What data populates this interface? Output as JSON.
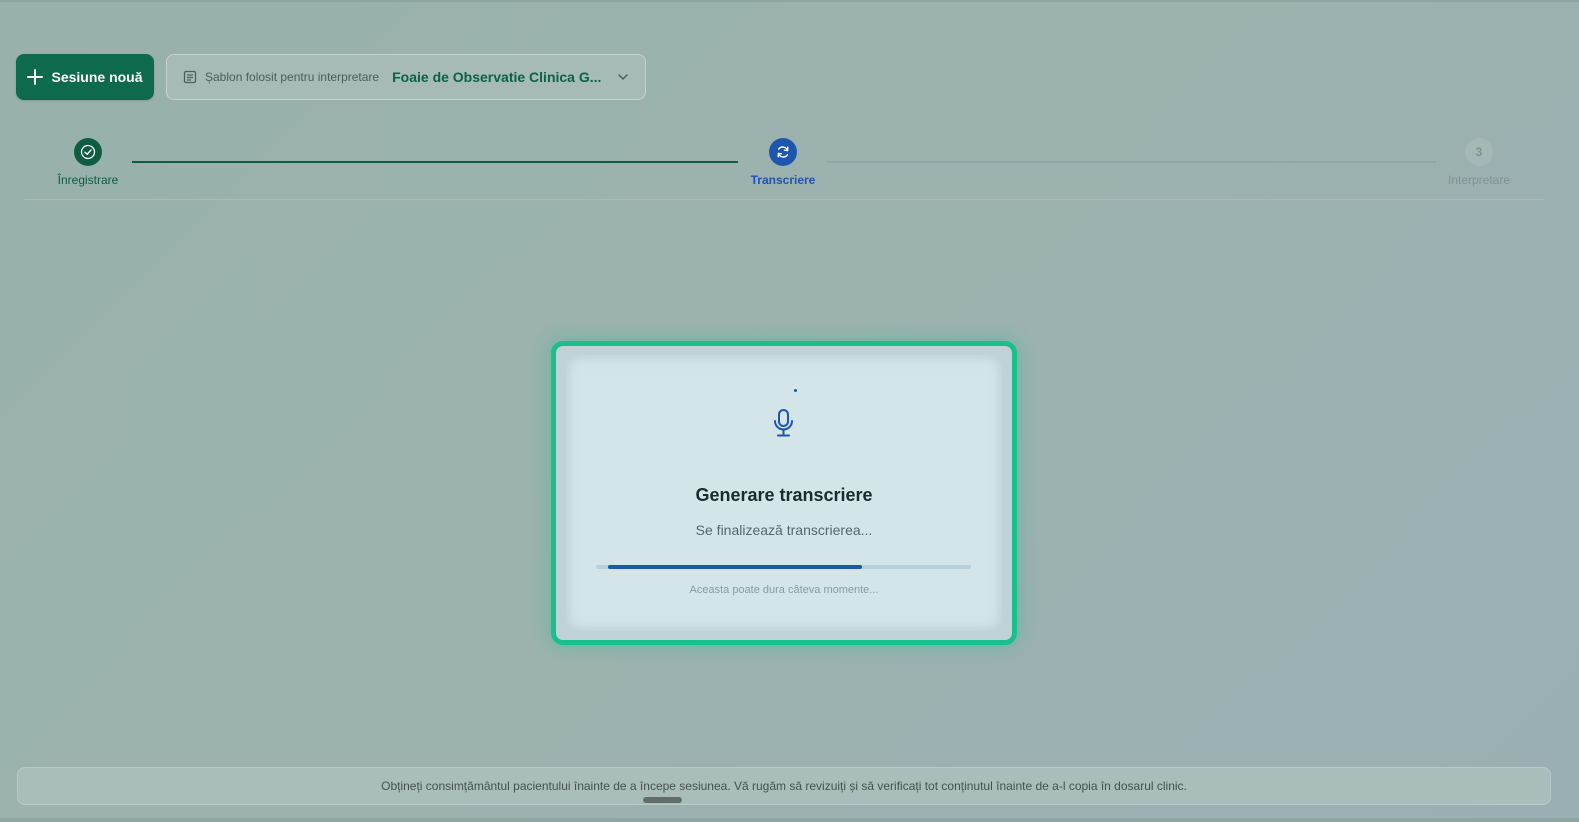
{
  "header": {
    "new_session_label": "Sesiune nouă",
    "template_label": "Șablon folosit pentru interpretare",
    "template_value": "Foaie de Observatie Clinica G..."
  },
  "stepper": {
    "steps": [
      {
        "label": "Înregistrare",
        "state": "done"
      },
      {
        "label": "Transcriere",
        "state": "active"
      },
      {
        "label": "Interpretare",
        "state": "pending",
        "number": "3"
      }
    ]
  },
  "modal": {
    "title": "Generare transcriere",
    "subtitle": "Se finalizează transcrierea...",
    "progress": 0.7,
    "hint": "Aceasta poate dura câteva momente..."
  },
  "footer": {
    "notice": "Obțineți consimțământul pacientului înainte de a începe sesiunea. Vă rugăm să revizuiți și să verificați tot conținutul înainte de a-l copia în dosarul clinic."
  },
  "colors": {
    "primary_green": "#0c5d42",
    "active_blue": "#1e55ad",
    "highlight_teal": "#18c08b"
  },
  "icons": {
    "new_session": "plus-icon",
    "template": "document-icon",
    "template_dropdown": "chevron-down-icon",
    "step_done": "check-circle-icon",
    "step_active": "refresh-icon",
    "modal": "microphone-icon"
  }
}
